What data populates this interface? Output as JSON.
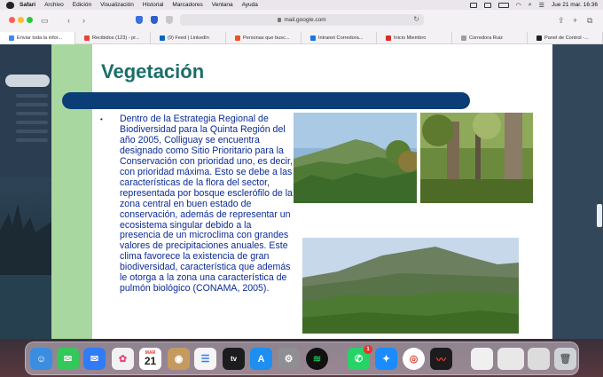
{
  "menubar": {
    "items": [
      "Safari",
      "Archivo",
      "Edición",
      "Visualización",
      "Historial",
      "Marcadores",
      "Ventana",
      "Ayuda"
    ],
    "datetime": "Jue 21 mar.  16:36"
  },
  "browser": {
    "url": "mail.google.com",
    "tabs": [
      {
        "label": "Enviar toda la infor...",
        "favicon_color": "#4285f4"
      },
      {
        "label": "Recibidos (123) - pr...",
        "favicon_color": "#ea4335"
      },
      {
        "label": "(9) Feed | LinkedIn",
        "favicon_color": "#0a66c2"
      },
      {
        "label": "Personas que busc...",
        "favicon_color": "#f4511e"
      },
      {
        "label": "Intranet Corredora...",
        "favicon_color": "#1a73e8"
      },
      {
        "label": "Inicio Miembro",
        "favicon_color": "#d93025"
      },
      {
        "label": "Corredora Ruiz",
        "favicon_color": "#9e9e9e"
      },
      {
        "label": "Panel de Control -...",
        "favicon_color": "#202124"
      }
    ]
  },
  "slide": {
    "title": "Vegetación",
    "bullet": "•",
    "body": "Dentro de la Estrategia Regional de Biodiversidad para la Quinta Región del año 2005, Colliguay se encuentra designado como Sitio Prioritario para la Conservación con prioridad uno, es decir, con prioridad máxima. Esto se debe a las características de la flora del sector, representada por bosque esclerófilo de la zona central en buen estado de conservación, además de representar un ecosistema singular debido a la presencia de un microclima con grandes valores de precipitaciones anuales. Este clima favorece la existencia de gran biodiversidad, característica que además le otorga a la zona una característica de pulmón biológico (CONAMA, 2005)."
  },
  "gmail_sidebar": {
    "labels": [
      "Recibidos",
      "Destacados",
      "Pospuestos",
      "Enviados",
      "Borradores",
      "Más"
    ]
  },
  "dock": {
    "calendar_month": "MAR",
    "calendar_day": "21",
    "whatsapp_badge": "1",
    "apps": [
      {
        "name": "finder",
        "color": "#3b8de0"
      },
      {
        "name": "messages",
        "color": "#34c759"
      },
      {
        "name": "mail",
        "color": "#2f7cf6"
      },
      {
        "name": "photos",
        "color": "#f2f2f2"
      },
      {
        "name": "calendar",
        "color": "#ffffff"
      },
      {
        "name": "contacts",
        "color": "#c59a5f"
      },
      {
        "name": "reminders",
        "color": "#f5f5f5"
      },
      {
        "name": "apple-tv",
        "color": "#1c1c1e"
      },
      {
        "name": "app-store",
        "color": "#1e8ef0"
      },
      {
        "name": "system-settings",
        "color": "#8e8e93"
      },
      {
        "name": "spotify",
        "color": "#1db954"
      },
      {
        "name": "whatsapp",
        "color": "#25d366"
      },
      {
        "name": "safari",
        "color": "#1a8cff"
      },
      {
        "name": "chrome",
        "color": "#ffffff"
      },
      {
        "name": "voice-memos",
        "color": "#1c1c1e"
      }
    ]
  }
}
